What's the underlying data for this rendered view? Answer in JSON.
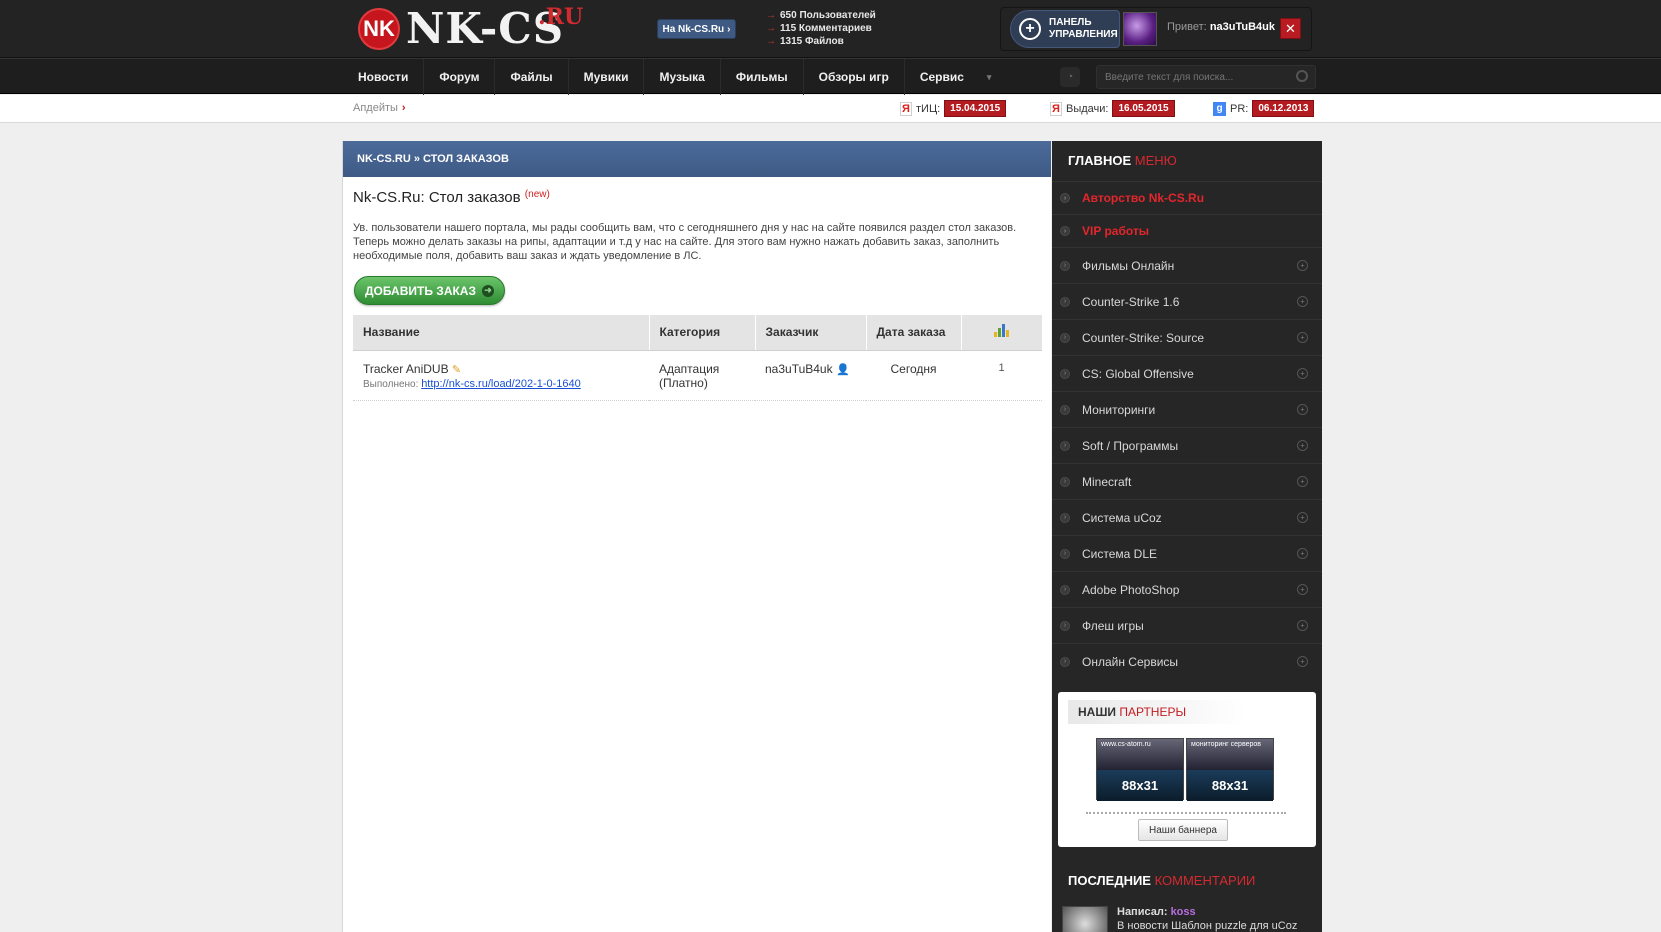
{
  "header": {
    "logo_badge": "NK",
    "logo_text": "NK-CS",
    "logo_suffix": ".RU",
    "goto_button": "На Nk-CS.Ru",
    "stats": [
      "650 Пользователей",
      "115 Комментариев",
      "1315 Файлов"
    ],
    "panel_button": [
      "ПАНЕЛЬ",
      "УПРАВЛЕНИЯ"
    ],
    "greeting_prefix": "Привет:",
    "username": "na3uTuB4uk",
    "close_glyph": "✕"
  },
  "nav": {
    "items": [
      "Новости",
      "Форум",
      "Файлы",
      "Мувики",
      "Музыка",
      "Фильмы",
      "Обзоры игр",
      "Сервис"
    ],
    "search_placeholder": "Введите текст для поиска..."
  },
  "infobar": {
    "updates_label": "Апдейты",
    "metrics": [
      {
        "icon": "Я",
        "label": "тИЦ:",
        "date": "15.04.2015"
      },
      {
        "icon": "Я",
        "label": "Выдачи:",
        "date": "16.05.2015"
      },
      {
        "icon": "g",
        "label": "PR:",
        "date": "06.12.2013"
      }
    ]
  },
  "main": {
    "breadcrumb": "NK-CS.RU » СТОЛ ЗАКАЗОВ",
    "title": "Nk-CS.Ru: Стол заказов",
    "title_badge": "(new)",
    "intro": "Ув. пользователи нашего портала, мы рады сообщить вам, что с сегодняшнего дня у нас на сайте появился раздел стол заказов. Теперь можно делать заказы на рипы, адаптации и т.д у нас на сайте. Для этого вам нужно нажать добавить заказ, заполнить необходимые поля, добавить ваш заказ и ждать уведомление в ЛС.",
    "add_button": "ДОБАВИТЬ ЗАКАЗ",
    "table": {
      "headers": [
        "Название",
        "Категория",
        "Заказчик",
        "Дата заказа"
      ],
      "rows": [
        {
          "name": "Tracker AniDUB",
          "done_label": "Выполнено:",
          "done_link": "http://nk-cs.ru/load/202-1-0-1640",
          "category_1": "Адаптация",
          "category_2": "(Платно)",
          "customer": "na3uTuB4uk",
          "date": "Сегодня",
          "count": "1"
        }
      ]
    }
  },
  "sidebar": {
    "menu_title_1": "ГЛАВНОЕ",
    "menu_title_2": "МЕНЮ",
    "menu": [
      "Авторство Nk-CS.Ru",
      "VIP работы",
      "Фильмы Онлайн",
      "Counter-Strike 1.6",
      "Counter-Strike: Source",
      "CS: Global Offensive",
      "Мониторинги",
      "Soft / Программы",
      "Minecraft",
      "Система uCoz",
      "Система DLE",
      "Adobe PhotoShop",
      "Флеш игры",
      "Онлайн Сервисы"
    ],
    "partners_title_1": "НАШИ",
    "partners_title_2": "ПАРТНЕРЫ",
    "banners": [
      {
        "top": "www.cs-atom.ru",
        "size": "88x31"
      },
      {
        "top": "мониторинг серверов",
        "size": "88x31"
      }
    ],
    "banners_button": "Наши баннера",
    "comments_title_1": "ПОСЛЕДНИЕ",
    "comments_title_2": "КОММЕНТАРИИ",
    "comment_author_label": "Написал:",
    "comment_author": "koss",
    "comment_text": "В новости Шаблон puzzle для uCoz"
  },
  "colors": {
    "brand_red": "#c4161c",
    "breadcrumb_blue": "#4c6b9a",
    "add_green": "#2f8d34",
    "link_blue": "#1a4fd6"
  }
}
